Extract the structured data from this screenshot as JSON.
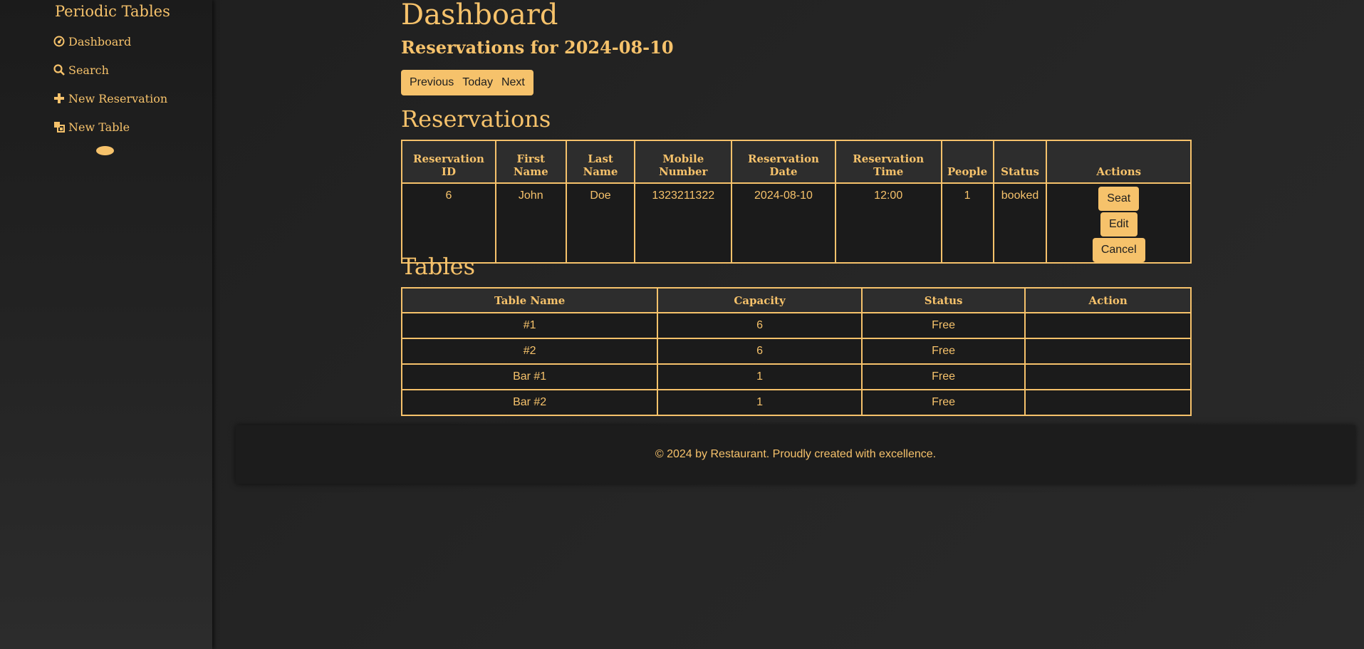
{
  "sidebar": {
    "brand": "Periodic Tables",
    "items": [
      {
        "label": "Dashboard",
        "icon": "dashboard-icon"
      },
      {
        "label": "Search",
        "icon": "search-icon"
      },
      {
        "label": "New Reservation",
        "icon": "plus-icon"
      },
      {
        "label": "New Table",
        "icon": "new-table-icon"
      }
    ]
  },
  "main": {
    "title": "Dashboard",
    "subtitle": "Reservations for 2024-08-10",
    "date_nav": {
      "previous": "Previous",
      "today": "Today",
      "next": "Next"
    },
    "reservations": {
      "heading": "Reservations",
      "columns": [
        "Reservation ID",
        "First Name",
        "Last Name",
        "Mobile Number",
        "Reservation Date",
        "Reservation Time",
        "People",
        "Status",
        "Actions"
      ],
      "rows": [
        {
          "id": "6",
          "first_name": "John",
          "last_name": "Doe",
          "mobile": "1323211322",
          "date": "2024-08-10",
          "time": "12:00",
          "people": "1",
          "status": "booked",
          "actions": {
            "seat": "Seat",
            "edit": "Edit",
            "cancel": "Cancel"
          }
        }
      ]
    },
    "tables": {
      "heading": "Tables",
      "columns": [
        "Table Name",
        "Capacity",
        "Status",
        "Action"
      ],
      "rows": [
        {
          "name": "#1",
          "capacity": "6",
          "status": "Free",
          "action": ""
        },
        {
          "name": "#2",
          "capacity": "6",
          "status": "Free",
          "action": ""
        },
        {
          "name": "Bar #1",
          "capacity": "1",
          "status": "Free",
          "action": ""
        },
        {
          "name": "Bar #2",
          "capacity": "1",
          "status": "Free",
          "action": ""
        }
      ]
    }
  },
  "footer": {
    "text": "© 2024 by Restaurant. Proudly created with excellence."
  },
  "colors": {
    "accent": "#f6c26b",
    "background": "#232323",
    "cell_background": "#1b1b1b"
  }
}
